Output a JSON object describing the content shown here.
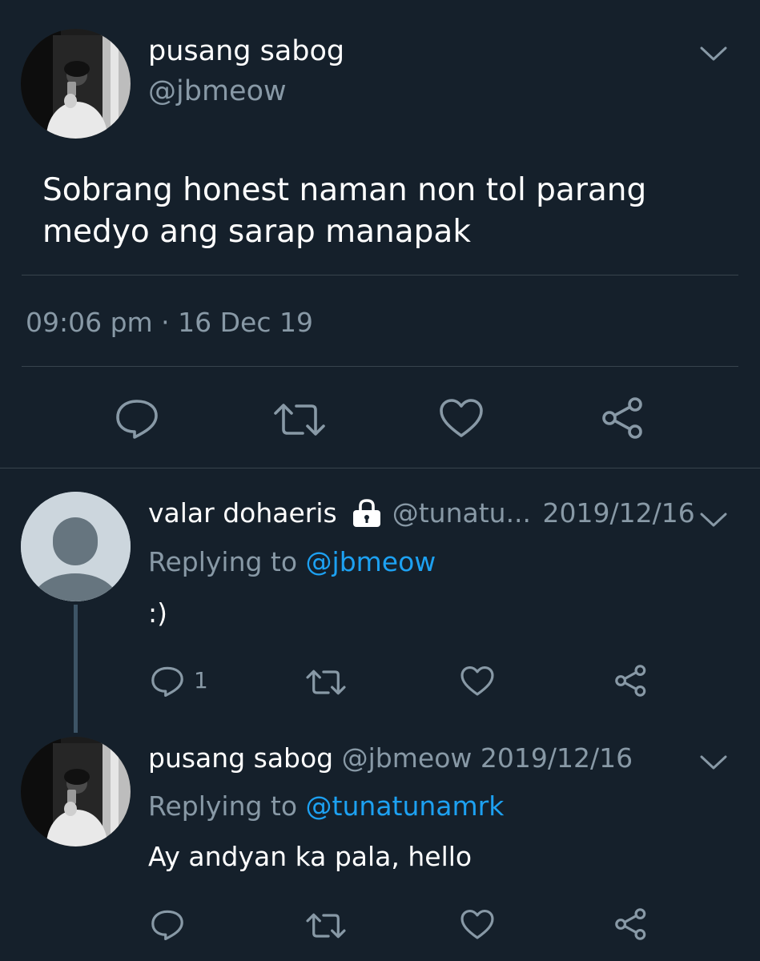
{
  "main_tweet": {
    "display_name": "pusang sabog",
    "handle": "@jbmeow",
    "text": "Sobrang honest naman non tol parang medyo ang sarap manapak",
    "timestamp": "09:06 pm · 16 Dec 19"
  },
  "replies": [
    {
      "display_name": "valar dohaeris",
      "handle": "@tunatu...",
      "date": "2019/12/16",
      "replying_prefix": "Replying to",
      "replying_to": "@jbmeow",
      "text": ":)",
      "reply_count": "1",
      "protected": true
    },
    {
      "display_name": "pusang sabog",
      "handle": "@jbmeow",
      "date": "2019/12/16",
      "replying_prefix": "Replying to",
      "replying_to": "@tunatunamrk",
      "text": "Ay andyan ka pala, hello"
    }
  ],
  "colors": {
    "background": "#15202b",
    "text_primary": "#ffffff",
    "text_secondary": "#8899a6",
    "link": "#1da1f2",
    "divider": "#38444d"
  },
  "icons": {
    "reply": "reply-icon",
    "retweet": "retweet-icon",
    "like": "heart-icon",
    "share": "share-icon",
    "menu": "chevron-down-icon",
    "protected": "lock-icon"
  }
}
